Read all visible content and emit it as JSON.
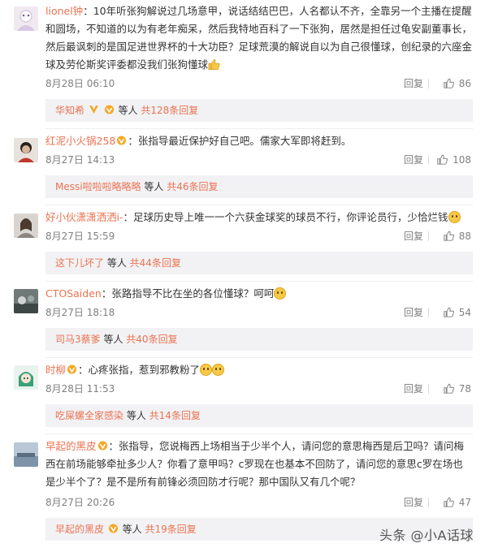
{
  "comments": [
    {
      "username": "lionel钟",
      "text": "10年听张狗解说过几场意甲，说话结结巴巴，人名都认不齐，全靠另一个主播在提醒和圆场，不知道的以为有老年痴呆，然后我特地百科了一下张狗，居然是担任过龟安副董事长，然后最讽刺的是国足进世界杯的十大功臣？足球荒漠的解说自以为自己很懂球，创纪录的六座金球及劳伦斯奖评委都没我们张狗懂球",
      "time": "8月28日 06:10",
      "reply": "回复",
      "likes": "86",
      "sub_user": "华知希",
      "sub_mid": " 等人 ",
      "sub_count": "共128条回复"
    },
    {
      "username": "红泥小火锅258",
      "text": "张指导最近保护好自己吧。儒家大军即将赶到。",
      "time": "8月27日 14:13",
      "reply": "回复",
      "likes": "108",
      "sub_user": "Messi啦啦啦略略略",
      "sub_mid": " 等人 ",
      "sub_count": "共46条回复"
    },
    {
      "username": "好小伙潇潇洒洒i-",
      "text": "足球历史导上唯一一个六获金球奖的球员不行，你评论员行，少恰烂钱",
      "time": "8月27日 15:59",
      "reply": "回复",
      "likes": "88",
      "sub_user": "这下儿坏了",
      "sub_mid": " 等人 ",
      "sub_count": "共44条回复"
    },
    {
      "username": "CTOSaiden",
      "text": "张路指导不比在坐的各位懂球？呵呵",
      "time": "8月27日 18:18",
      "reply": "回复",
      "likes": "54",
      "sub_user": "司马3蔡爹",
      "sub_mid": " 等人 ",
      "sub_count": "共40条回复"
    },
    {
      "username": "时柳",
      "text": "心疼张指，惹到邪教粉了",
      "time": "8月28日 11:53",
      "reply": "回复",
      "likes": "78",
      "sub_user": "吃屎螺全家感染",
      "sub_mid": " 等人 ",
      "sub_count": "共14条回复"
    },
    {
      "username": "早起的黑皮",
      "text": "张指导，您说梅西上场相当于少半个人，请问您的意思梅西是后卫吗？请问梅西在前场能够牵扯多少人？你看了意甲吗？c罗现在也基本不回防了，请问您的意思c罗在场也是少半个了？是不是所有前锋必须回防才行呢？那中国队又有几个呢？",
      "time": "8月27日 20:26",
      "reply": "回复",
      "likes": "47",
      "sub_user": "早起的黑皮",
      "sub_mid": " 等人 ",
      "sub_count": "共19条回复"
    }
  ],
  "watermark": "头条 @小A话球",
  "colors": {
    "name": "#eb7350",
    "meta": "#808080",
    "subbg": "#f2f2f5"
  },
  "icons": {
    "like": "thumbs-up-icon",
    "vip": "vip-badge-icon"
  }
}
